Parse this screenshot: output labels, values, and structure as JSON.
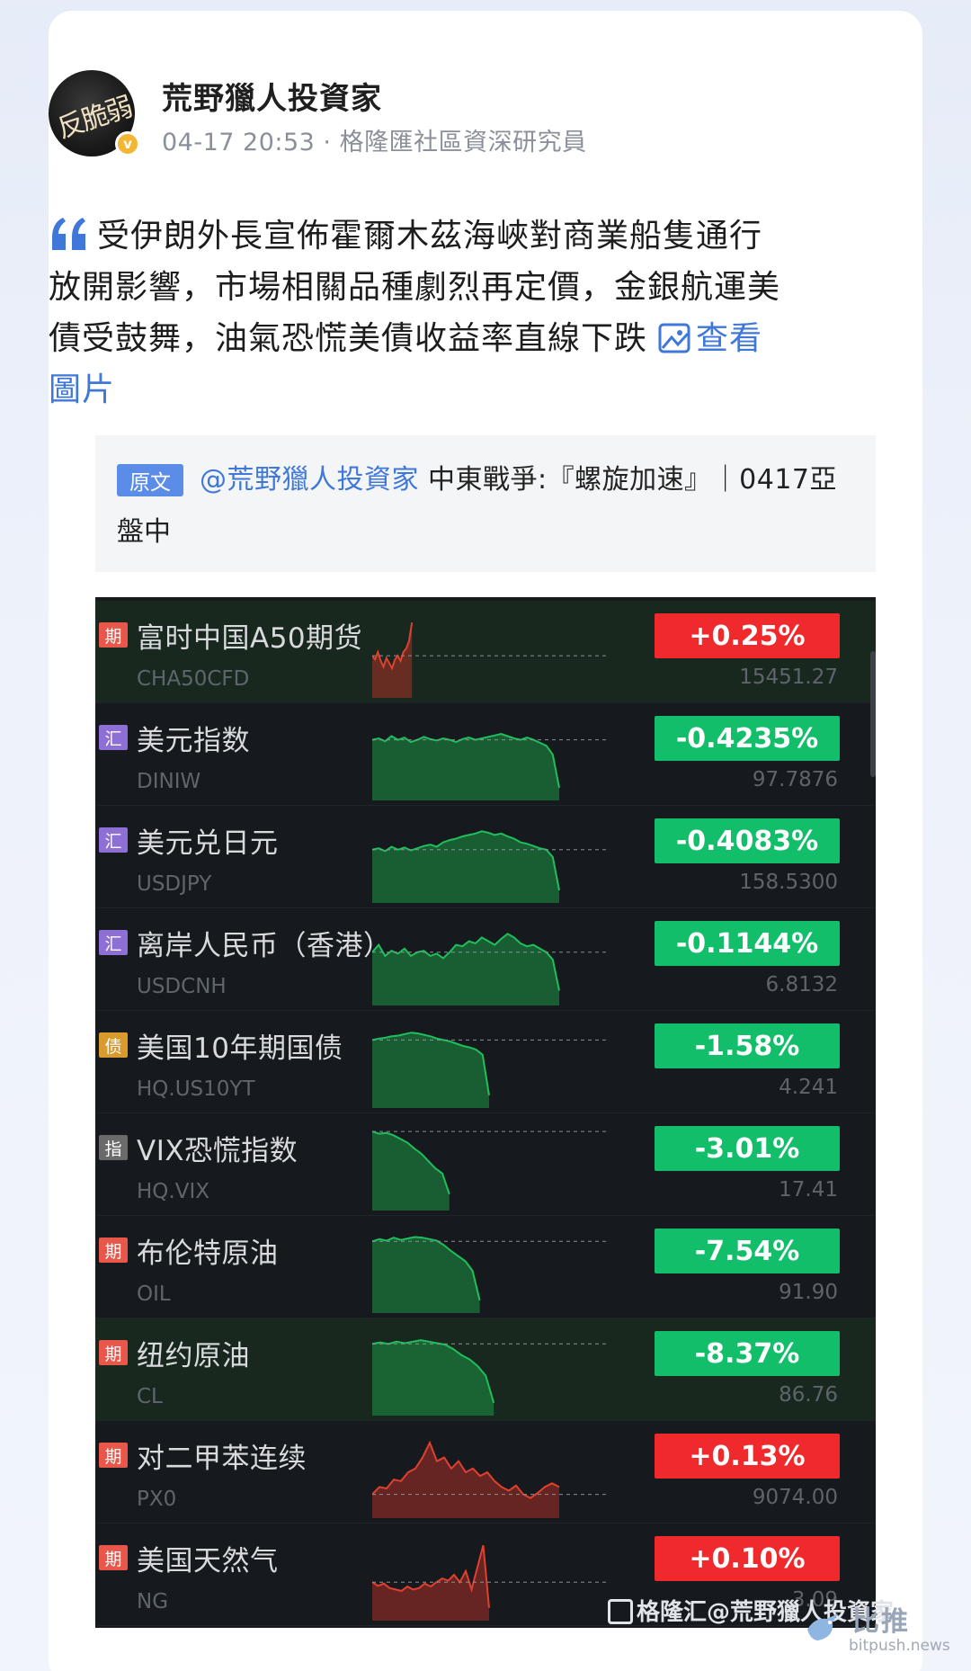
{
  "post": {
    "author": {
      "avatar_text": "反脆弱",
      "verified_mark": "v",
      "name": "荒野獵人投資家",
      "meta": "04-17 20:53 · 格隆匯社區資深研究員"
    },
    "content": {
      "line1": "受伊朗外長宣佈霍爾木茲海峽對商業船隻通行",
      "line2": "放開影響，市場相關品種劇烈再定價，金銀航運美",
      "line3": "債受鼓舞，油氣恐慌美債收益率直線下跌",
      "view_label_part1": "查看",
      "view_label_part2": "圖片",
      "quote_icon": "quote-icon",
      "image_icon": "image-icon"
    },
    "original": {
      "tag": "原文",
      "mention": "@荒野獵人投資家",
      "title_part1": " 中東戰爭:『螺旋加速』｜0417亞",
      "title_part2": "盤中"
    }
  },
  "colors": {
    "up": "#f0292c",
    "down": "#13be6a",
    "link": "#3f78d8",
    "panel_bg": "#161a1e"
  },
  "instruments": [
    {
      "badge": "期",
      "badge_type": "period",
      "name": "富时中国A50期货",
      "code": "CHA50CFD",
      "change": "+0.25%",
      "direction": "up",
      "price": "15451.27",
      "highlight": true,
      "spark": [
        0.55,
        0.6,
        0.5,
        0.62,
        0.7,
        0.58,
        0.65,
        0.72,
        0.6,
        0.55,
        0.62,
        0.5,
        0.45,
        0.35,
        0.1
      ],
      "spark_len": 0.17
    },
    {
      "badge": "汇",
      "badge_type": "fx",
      "name": "美元指数",
      "code": "DINIW",
      "change": "-0.4235%",
      "direction": "down",
      "price": "97.7876",
      "highlight": false,
      "spark": [
        0.3,
        0.28,
        0.32,
        0.25,
        0.3,
        0.27,
        0.33,
        0.3,
        0.26,
        0.29,
        0.31,
        0.28,
        0.3,
        0.33,
        0.29,
        0.27,
        0.3,
        0.28,
        0.26,
        0.24,
        0.22,
        0.25,
        0.28,
        0.3,
        0.27,
        0.3,
        0.34,
        0.38,
        0.5,
        0.95
      ],
      "spark_len": 0.8
    },
    {
      "badge": "汇",
      "badge_type": "fx",
      "name": "美元兑日元",
      "code": "USDJPY",
      "change": "-0.4083%",
      "direction": "down",
      "price": "158.5300",
      "highlight": false,
      "spark": [
        0.4,
        0.38,
        0.42,
        0.36,
        0.4,
        0.37,
        0.41,
        0.38,
        0.35,
        0.33,
        0.36,
        0.3,
        0.27,
        0.25,
        0.22,
        0.2,
        0.18,
        0.15,
        0.17,
        0.2,
        0.18,
        0.22,
        0.25,
        0.3,
        0.32,
        0.35,
        0.38,
        0.4,
        0.5,
        0.95
      ],
      "spark_len": 0.8
    },
    {
      "badge": "汇",
      "badge_type": "fx",
      "name": "离岸人民币（香港）",
      "code": "USDCNH",
      "change": "-0.1144%",
      "direction": "down",
      "price": "6.8132",
      "highlight": false,
      "spark": [
        0.4,
        0.3,
        0.45,
        0.38,
        0.42,
        0.35,
        0.45,
        0.4,
        0.38,
        0.45,
        0.42,
        0.48,
        0.4,
        0.3,
        0.32,
        0.25,
        0.28,
        0.2,
        0.25,
        0.3,
        0.22,
        0.15,
        0.2,
        0.28,
        0.32,
        0.3,
        0.35,
        0.4,
        0.5,
        0.92
      ],
      "spark_len": 0.8
    },
    {
      "badge": "债",
      "badge_type": "bond",
      "name": "美国10年期国债",
      "code": "HQ.US10YT",
      "change": "-1.58%",
      "direction": "down",
      "price": "4.241",
      "highlight": false,
      "spark": [
        0.2,
        0.18,
        0.17,
        0.15,
        0.14,
        0.12,
        0.1,
        0.11,
        0.13,
        0.15,
        0.18,
        0.2,
        0.22,
        0.25,
        0.28,
        0.3,
        0.33,
        0.4,
        0.95
      ],
      "spark_len": 0.5
    },
    {
      "badge": "指",
      "badge_type": "index",
      "name": "VIX恐慌指数",
      "code": "HQ.VIX",
      "change": "-3.01%",
      "direction": "down",
      "price": "17.41",
      "highlight": false,
      "spark": [
        0.05,
        0.08,
        0.07,
        0.1,
        0.15,
        0.2,
        0.28,
        0.35,
        0.45,
        0.55,
        0.62,
        0.9
      ],
      "spark_len": 0.33
    },
    {
      "badge": "期",
      "badge_type": "period",
      "name": "布伦特原油",
      "code": "OIL",
      "change": "-7.54%",
      "direction": "down",
      "price": "91.90",
      "highlight": false,
      "spark": [
        0.15,
        0.12,
        0.14,
        0.1,
        0.13,
        0.11,
        0.09,
        0.1,
        0.12,
        0.14,
        0.2,
        0.28,
        0.35,
        0.42,
        0.55,
        0.95
      ],
      "spark_len": 0.46
    },
    {
      "badge": "期",
      "badge_type": "period",
      "name": "纽约原油",
      "code": "CL",
      "change": "-8.37%",
      "direction": "down",
      "price": "86.76",
      "highlight": true,
      "spark": [
        0.15,
        0.13,
        0.15,
        0.12,
        0.14,
        0.12,
        0.1,
        0.12,
        0.14,
        0.16,
        0.22,
        0.3,
        0.36,
        0.45,
        0.58,
        0.95
      ],
      "spark_len": 0.52
    },
    {
      "badge": "期",
      "badge_type": "period",
      "name": "对二甲苯连续",
      "code": "PX0",
      "change": "+0.13%",
      "direction": "up",
      "price": "9074.00",
      "highlight": false,
      "spark": [
        0.8,
        0.7,
        0.72,
        0.6,
        0.62,
        0.5,
        0.45,
        0.3,
        0.1,
        0.35,
        0.3,
        0.45,
        0.35,
        0.5,
        0.45,
        0.55,
        0.5,
        0.62,
        0.7,
        0.75,
        0.68,
        0.8,
        0.85,
        0.78,
        0.7,
        0.65,
        0.7
      ],
      "spark_len": 0.8
    },
    {
      "badge": "期",
      "badge_type": "period",
      "name": "美国天然气",
      "code": "NG",
      "change": "+0.10%",
      "direction": "up",
      "price": "3.09",
      "highlight": false,
      "spark": [
        0.6,
        0.65,
        0.62,
        0.68,
        0.7,
        0.72,
        0.66,
        0.7,
        0.68,
        0.62,
        0.66,
        0.6,
        0.55,
        0.58,
        0.5,
        0.6,
        0.45,
        0.7,
        0.4,
        0.1,
        0.95
      ],
      "spark_len": 0.5
    }
  ],
  "watermarks": {
    "gelonghui": "格隆汇@荒野獵人投資家",
    "bitpush": "比推",
    "bitpush_url": "bitpush.news"
  }
}
